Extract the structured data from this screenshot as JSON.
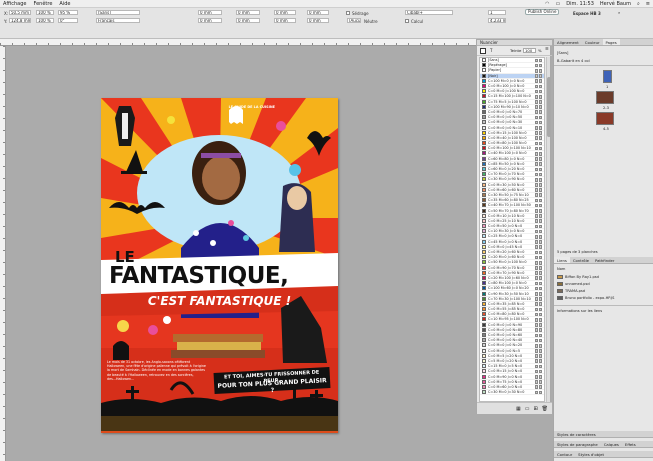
{
  "menubar": {
    "items": [
      "Affichage",
      "Fenêtre",
      "Aide"
    ],
    "right_items": [
      "Dim. 11:53",
      "Hervé Baum"
    ]
  },
  "controlbar": {
    "zoom_1": "100 %",
    "zoom_2": "100 %",
    "angle_1": "0°",
    "angle_2": "0°",
    "x_label": "X:",
    "y_label": "Y:",
    "x_value": "50,5 mm",
    "y_value": "124,8 mm",
    "w_value": "95 %",
    "font_name": "[Sans]",
    "language": "Français",
    "mm_1": "0 mm",
    "mm_2": "0 mm",
    "mm_3": "0 mm",
    "mm_4": "0 mm",
    "mm_5": "0 mm",
    "mm_6": "0 mm",
    "mm_7": "0 mm",
    "mm_8": "0 mm",
    "spacing_1": "0 mm",
    "spacing_2": "0 mm",
    "checkbox_1": "Sédrage",
    "checkbox_2": "Calcul",
    "none_label": "[Aucun]",
    "swatch_field": "Cibabl+",
    "mode_field": "Néutre",
    "count_1": "1",
    "count_2": "1",
    "page_value": "4,233 mm",
    "publish_button": "Publish Online",
    "workspace": "Espace HB 3"
  },
  "document": {
    "header_text": "LE GUIDE DE LA CUISINE",
    "title_le": "LE",
    "title_main": "FANTASTIQUE,",
    "subtitle": "C'EST FANTASTIQUE !",
    "body_copy": "Le mois de 31 octobre, les Anglo-saxons célèbrent Halloween, une fête d'origine païenne qui prévoit à l'origine la mort de Samhain. Déclinée en mode en bonnes galantes de beauté à l'Halloween, retrouvez en des sorcières, des...Hallowen...",
    "tagline_1": "ET TOI, AIMES-TU FRISSONNER DE PEUR,",
    "tagline_2": "POUR TON PLUS GRAND PLAISIR ?"
  },
  "swatches_panel": {
    "tab_label": "Nuancier",
    "tint_label": "Teinte",
    "tint_value": "100",
    "tint_unit": "%",
    "rows": [
      {
        "name": "[Sans]",
        "color": "#ffffff"
      },
      {
        "name": "[Repérage]",
        "color": "#000000"
      },
      {
        "name": "[Papier]",
        "color": "#ffffff"
      },
      {
        "name": "[Noir]",
        "color": "#111111"
      },
      {
        "name": "C=100 M=0 J=0 N=0",
        "color": "#00a3e0"
      },
      {
        "name": "C=0 M=100 J=0 N=0",
        "color": "#e4007c"
      },
      {
        "name": "C=0 M=0 J=100 N=0",
        "color": "#fff200"
      },
      {
        "name": "C=15 M=100 J=100 N=0",
        "color": "#c8102e"
      },
      {
        "name": "C=75 M=5 J=100 N=0",
        "color": "#4caf2c"
      },
      {
        "name": "C=100 M=90 J=10 N=0",
        "color": "#1f2a7a"
      },
      {
        "name": "C=0 M=0 J=0 N=70",
        "color": "#6b6b6b"
      },
      {
        "name": "C=0 M=0 J=0 N=50",
        "color": "#9a9a9a"
      },
      {
        "name": "C=0 M=0 J=0 N=30",
        "color": "#c4c4c4"
      },
      {
        "name": "C=0 M=0 J=0 N=10",
        "color": "#ececec"
      },
      {
        "name": "C=0 M=15 J=100 N=0",
        "color": "#ffd200"
      },
      {
        "name": "C=0 M=40 J=100 N=0",
        "color": "#f7a600"
      },
      {
        "name": "C=0 M=80 J=100 N=0",
        "color": "#e94e1b"
      },
      {
        "name": "C=0 M=100 J=100 N=10",
        "color": "#d0101d"
      },
      {
        "name": "C=40 M=100 J=0 N=0",
        "color": "#a3167e"
      },
      {
        "name": "C=60 M=80 J=0 N=0",
        "color": "#6f3f96"
      },
      {
        "name": "C=85 M=50 J=0 N=0",
        "color": "#1e6fb8"
      },
      {
        "name": "C=60 M=0 J=20 N=0",
        "color": "#56c2d0"
      },
      {
        "name": "C=70 M=0 J=70 N=0",
        "color": "#3fb46a"
      },
      {
        "name": "C=30 M=0 J=90 N=0",
        "color": "#bcd232"
      },
      {
        "name": "C=0 M=30 J=50 N=0",
        "color": "#fbbd86"
      },
      {
        "name": "C=0 M=60 J=60 N=0",
        "color": "#f28c62"
      },
      {
        "name": "C=30 M=50 J=75 N=10",
        "color": "#a87b4f"
      },
      {
        "name": "C=35 M=60 J=80 N=25",
        "color": "#8b5a32"
      },
      {
        "name": "C=40 M=70 J=100 N=50",
        "color": "#5a3818"
      },
      {
        "name": "C=50 M=70 J=80 N=70",
        "color": "#3d2817"
      },
      {
        "name": "C=0 M=10 J=10 N=0",
        "color": "#fde8dc"
      },
      {
        "name": "C=0 M=25 J=10 N=0",
        "color": "#f9c7c9"
      },
      {
        "name": "C=0 M=50 J=0 N=0",
        "color": "#f49ac1"
      },
      {
        "name": "C=10 M=30 J=0 N=0",
        "color": "#deb3d4"
      },
      {
        "name": "C=25 M=0 J=0 N=0",
        "color": "#bfe6f7"
      },
      {
        "name": "C=45 M=0 J=0 N=0",
        "color": "#86cff0"
      },
      {
        "name": "C=0 M=0 J=45 N=0",
        "color": "#fff59c"
      },
      {
        "name": "C=0 M=20 J=60 N=0",
        "color": "#fccf6e"
      },
      {
        "name": "C=20 M=0 J=60 N=0",
        "color": "#d7e784"
      },
      {
        "name": "C=50 M=0 J=100 N=0",
        "color": "#8dc63f"
      },
      {
        "name": "C=0 M=90 J=70 N=0",
        "color": "#e73a3f"
      },
      {
        "name": "C=0 M=70 J=90 N=0",
        "color": "#ee6b25"
      },
      {
        "name": "C=20 M=100 J=60 N=0",
        "color": "#c4145a"
      },
      {
        "name": "C=80 M=100 J=0 N=0",
        "color": "#482f8f"
      },
      {
        "name": "C=100 M=60 J=0 N=20",
        "color": "#00539b"
      },
      {
        "name": "C=90 M=30 J=50 N=10",
        "color": "#007a7a"
      },
      {
        "name": "C=70 M=30 J=100 N=10",
        "color": "#4d8a2f"
      },
      {
        "name": "C=0 M=35 J=85 N=0",
        "color": "#f9b233"
      },
      {
        "name": "C=0 M=55 J=85 N=0",
        "color": "#f18a2a"
      },
      {
        "name": "C=0 M=80 J=80 N=0",
        "color": "#e8512c"
      },
      {
        "name": "C=10 M=95 J=100 N=0",
        "color": "#d4241c"
      },
      {
        "name": "C=0 M=0 J=0 N=90",
        "color": "#3a3a3a"
      },
      {
        "name": "C=0 M=0 J=0 N=80",
        "color": "#555555"
      },
      {
        "name": "C=0 M=0 J=0 N=60",
        "color": "#808080"
      },
      {
        "name": "C=0 M=0 J=0 N=40",
        "color": "#adadad"
      },
      {
        "name": "C=0 M=0 J=0 N=20",
        "color": "#d7d7d7"
      },
      {
        "name": "C=0 M=0 J=0 N=5",
        "color": "#f4f4f4"
      },
      {
        "name": "C=0 M=5 J=20 N=0",
        "color": "#fff4d6"
      },
      {
        "name": "C=5 M=0 J=20 N=0",
        "color": "#f8fad6"
      },
      {
        "name": "C=15 M=0 J=5 N=0",
        "color": "#dff2f8"
      },
      {
        "name": "C=0 M=15 J=0 N=0",
        "color": "#fbe0ec"
      },
      {
        "name": "C=0 M=90 J=0 N=0",
        "color": "#e52d8a"
      },
      {
        "name": "C=0 M=75 J=0 N=0",
        "color": "#ea5d9f"
      },
      {
        "name": "C=0 M=60 J=0 N=0",
        "color": "#ef85b5"
      },
      {
        "name": "C=30 M=0 J=30 N=0",
        "color": "#bfe1c4"
      }
    ],
    "selected_index": 3
  },
  "dock": {
    "top_tabs": [
      "Alignement",
      "Couleur",
      "Pages"
    ],
    "pages_none": "[Sans]",
    "master_label": "B-Gabarit en 4 col",
    "spread_label_1": "1",
    "spread_label_2": "2-3",
    "spread_label_3": "4-5",
    "pages_status": "5 pages de 3 planches",
    "layers_tabs": [
      "Liens",
      "Contrôle",
      "Pathfinder"
    ],
    "links_header": "Nom",
    "links": [
      {
        "name": "Biffon By Ray1.psd",
        "color": "#c89a4a"
      },
      {
        "name": "unnamed.psd",
        "color": "#8a6f3a"
      },
      {
        "name": "TRAMA.psd",
        "color": "#7a6a5a"
      },
      {
        "name": "Bruno portfolio - expo-HP.JS",
        "color": "#5e5e5e"
      }
    ],
    "links_info": "Informations sur les liens",
    "bottom_tabs_1": [
      "Styles de caractères"
    ],
    "bottom_tabs_2": [
      "Styles de paragraphe",
      "Calques",
      "Effets"
    ],
    "bottom_tabs_3": [
      "Contour",
      "Styles d'objet"
    ]
  },
  "colors": {
    "poster_orange": "#f4a520",
    "poster_red": "#e63a1f",
    "sky_blue": "#bfe6f7",
    "selection": "#bcd3f3"
  }
}
